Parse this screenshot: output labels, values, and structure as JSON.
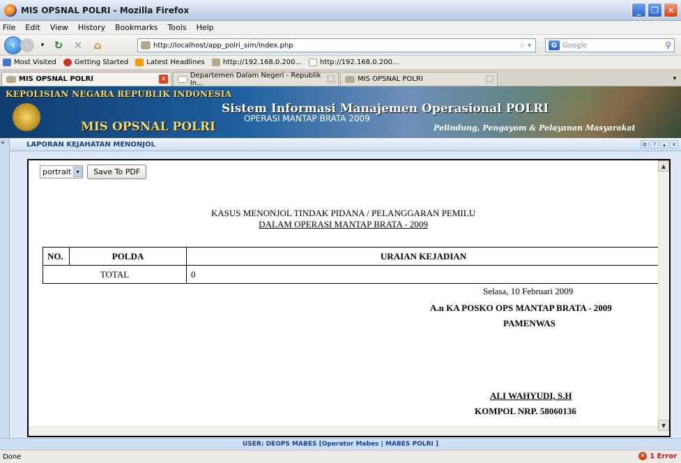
{
  "window": {
    "title": "MIS OPSNAL POLRI - Mozilla Firefox"
  },
  "menu": [
    "File",
    "Edit",
    "View",
    "History",
    "Bookmarks",
    "Tools",
    "Help"
  ],
  "nav": {
    "url": "http://localhost/app_polri_sim/index.php",
    "search_placeholder": "Google"
  },
  "bookmarks": [
    "Most Visited",
    "Getting Started",
    "Latest Headlines",
    "http://192.168.0.200...",
    "http://192.168.0.200..."
  ],
  "tabs": [
    {
      "label": "MIS OPSNAL POLRI",
      "active": true
    },
    {
      "label": "Departemen Dalam Negeri - Republik In...",
      "active": false
    },
    {
      "label": "MIS OPSNAL POLRI",
      "active": false
    }
  ],
  "banner": {
    "org": "KEPOLISIAN NEGARA REPUBLIK INDONESIA",
    "app_short": "MIS OPSNAL POLRI",
    "app_full": "Sistem Informasi Manajemen Operasional POLRI",
    "operation": "OPERASI MANTAP BRATA 2009",
    "motto": "Pelindung, Pengayom & Pelayanan Masyarakat"
  },
  "panel": {
    "title": "LAPORAN KEJAHATAN MENONJOL"
  },
  "doc": {
    "orientation": "portrait",
    "save_pdf": "Save To PDF",
    "title_line1": "KASUS MENONJOL TINDAK PIDANA / PELANGGARAN PEMILU",
    "title_line2": "DALAM OPERASI MANTAP BRATA - 2009",
    "columns": [
      "NO.",
      "POLDA",
      "URAIAN KEJADIAN"
    ],
    "total_label": "TOTAL",
    "total_value": "0",
    "date": "Selasa, 10 Februari 2009",
    "signer_title": "A.n KA POSKO OPS MANTAP BRATA - 2009",
    "signer_role": "PAMENWAS",
    "signer_name": "ALI WAHYUDI, S.H",
    "signer_rank": "KOMPOL NRP. 58060136"
  },
  "userbar": "USER: DEOPS MABES [Operator Mabes | MABES POLRI ]",
  "status": {
    "text": "Done",
    "errors": "1 Error"
  }
}
